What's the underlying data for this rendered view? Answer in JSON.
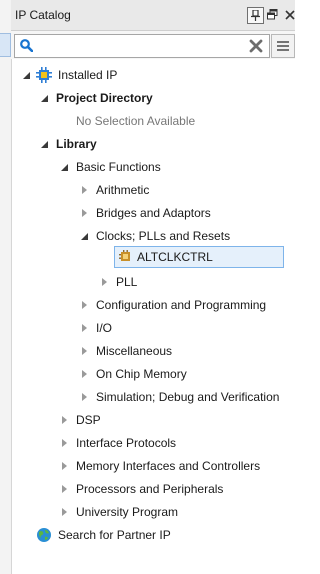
{
  "window": {
    "title": "IP Catalog"
  },
  "search": {
    "value": "",
    "placeholder": ""
  },
  "tree": {
    "installed_ip": "Installed IP",
    "project_directory": "Project Directory",
    "no_selection": "No Selection Available",
    "library": "Library",
    "basic_functions": "Basic Functions",
    "arithmetic": "Arithmetic",
    "bridges": "Bridges and Adaptors",
    "clocks": "Clocks; PLLs and Resets",
    "altclkctrl": "ALTCLKCTRL",
    "pll": "PLL",
    "config_programming": "Configuration and Programming",
    "io": "I/O",
    "misc": "Miscellaneous",
    "on_chip_memory": "On Chip Memory",
    "simulation": "Simulation; Debug and Verification",
    "dsp": "DSP",
    "interface_protocols": "Interface Protocols",
    "memory_interfaces": "Memory Interfaces and Controllers",
    "processors": "Processors and Peripherals",
    "university": "University Program",
    "partner_ip": "Search for Partner IP"
  },
  "icons": {
    "titlebar": [
      "pin-icon",
      "float-window-icon",
      "close-icon"
    ],
    "search": "search-icon",
    "clear": "clear-icon",
    "menu": "menu-icon",
    "installed": "installed-ip-icon",
    "ip_core": "ip-core-icon",
    "partner": "globe-icon"
  },
  "colors": {
    "selection_bg": "#e5f0fb",
    "selection_border": "#7eb4ea",
    "search_icon": "#1874d0",
    "globe": "#2a8fd4"
  }
}
